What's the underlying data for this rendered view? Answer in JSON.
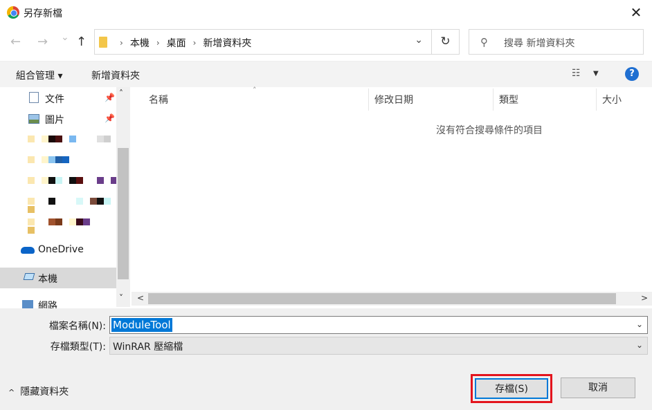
{
  "window": {
    "title": "另存新檔",
    "close_glyph": "✕"
  },
  "nav": {
    "back_glyph": "←",
    "forward_glyph": "→",
    "recent_glyph": "⌄",
    "up_glyph": "↑",
    "breadcrumbs": [
      "本機",
      "桌面",
      "新增資料夾"
    ],
    "crumb_sep": "›",
    "address_dropdown_glyph": "⌄",
    "refresh_glyph": "↻",
    "search_icon_glyph": "⚲",
    "search_placeholder": "搜尋 新增資料夾"
  },
  "toolbar": {
    "organize_label": "組合管理 ▾",
    "new_folder_label": "新增資料夾",
    "view_glyph": "☷",
    "view_dd_glyph": "▼",
    "help_glyph": "?"
  },
  "navpane": {
    "items": [
      {
        "label": "文件",
        "pinned": true
      },
      {
        "label": "圖片",
        "pinned": true
      },
      {
        "label": "OneDrive"
      },
      {
        "label": "本機",
        "selected": true
      },
      {
        "label": "網路"
      }
    ],
    "pin_glyph": "📌",
    "scroll_up_glyph": "˄",
    "scroll_down_glyph": "˅"
  },
  "filelist": {
    "columns": [
      "名稱",
      "修改日期",
      "類型",
      "大小"
    ],
    "sort_glyph": "˄",
    "empty_message": "沒有符合搜尋條件的項目",
    "hscroll_left": "<",
    "hscroll_right": ">"
  },
  "form": {
    "filename_label": "檔案名稱(N):",
    "filename_value": "ModuleTool",
    "filetype_label": "存檔類型(T):",
    "filetype_value": "WinRAR 壓縮檔",
    "dropdown_glyph": "⌄",
    "hide_folders_caret": "^",
    "hide_folders_label": "隱藏資料夾",
    "save_label": "存檔(S)",
    "cancel_label": "取消"
  },
  "colors": {
    "accent": "#0078d7",
    "highlight_outline": "#e3141d",
    "help_blue": "#1f6fd1"
  }
}
